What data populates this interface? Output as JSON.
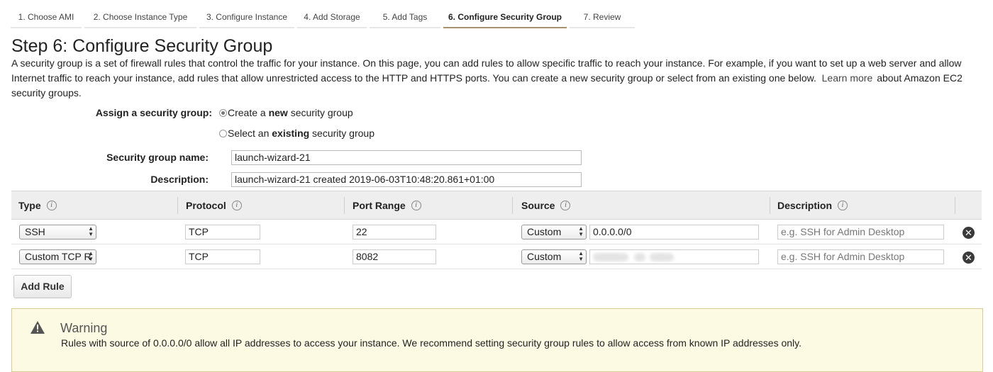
{
  "wizard": {
    "steps": [
      {
        "label": "1. Choose AMI",
        "active": false
      },
      {
        "label": "2. Choose Instance Type",
        "active": false
      },
      {
        "label": "3. Configure Instance",
        "active": false
      },
      {
        "label": "4. Add Storage",
        "active": false
      },
      {
        "label": "5. Add Tags",
        "active": false
      },
      {
        "label": "6. Configure Security Group",
        "active": true
      },
      {
        "label": "7. Review",
        "active": false
      }
    ]
  },
  "page": {
    "title": "Step 6: Configure Security Group",
    "intro_text": "A security group is a set of firewall rules that control the traffic for your instance. On this page, you can add rules to allow specific traffic to reach your instance. For example, if you want to set up a web server and allow Internet traffic to reach your instance, add rules that allow unrestricted access to the HTTP and HTTPS ports. You can create a new security group or select from an existing one below.",
    "learn_more": "Learn more",
    "intro_suffix": "about Amazon EC2 security groups."
  },
  "assign": {
    "label": "Assign a security group:",
    "option_new_prefix": "Create a ",
    "option_new_bold": "new",
    "option_new_suffix": " security group",
    "option_existing_prefix": "Select an ",
    "option_existing_bold": "existing",
    "option_existing_suffix": " security group",
    "selected": "new"
  },
  "group": {
    "name_label": "Security group name:",
    "name_value": "launch-wizard-21",
    "description_label": "Description:",
    "description_value": "launch-wizard-21 created 2019-06-03T10:48:20.861+01:00"
  },
  "table": {
    "headers": {
      "type": "Type",
      "protocol": "Protocol",
      "port_range": "Port Range",
      "source": "Source",
      "description": "Description"
    },
    "info_glyph": "i",
    "rows": [
      {
        "type": "SSH",
        "protocol": "TCP",
        "port_range": "22",
        "source_type": "Custom",
        "source_value": "0.0.0.0/0",
        "description_placeholder": "e.g. SSH for Admin Desktop"
      },
      {
        "type": "Custom TCP R",
        "protocol": "TCP",
        "port_range": "8082",
        "source_type": "Custom",
        "source_value": "",
        "description_placeholder": "e.g. SSH for Admin Desktop"
      }
    ],
    "remove_icon": "remove-circle-icon",
    "add_rule_label": "Add Rule"
  },
  "warning": {
    "icon": "warning-triangle-icon",
    "title": "Warning",
    "text": "Rules with source of 0.0.0.0/0 allow all IP addresses to access your instance. We recommend setting security group rules to allow access from known IP addresses only."
  },
  "colors": {
    "active_tab_underline": "#a8906f",
    "warning_background": "#fdfae4",
    "table_header": "#eeeeee"
  }
}
